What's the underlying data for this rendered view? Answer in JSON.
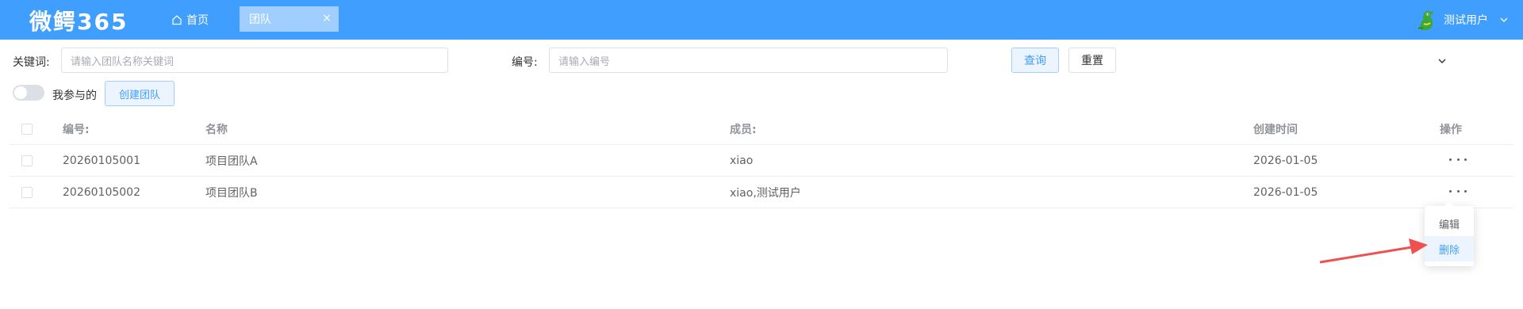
{
  "header": {
    "logo": "微鳄365",
    "nav_home": "首页",
    "active_tab": "团队",
    "user_name": "测试用户",
    "bg_color": "#409eff"
  },
  "search": {
    "keyword_label": "关键词:",
    "keyword_placeholder": "请输入团队名称关键词",
    "code_label": "编号:",
    "code_placeholder": "请输入编号",
    "query_button": "查询",
    "reset_button": "重置"
  },
  "toolbar": {
    "toggle_label": "我参与的",
    "toggle_on": false,
    "create_button": "创建团队"
  },
  "table": {
    "columns": [
      "编号:",
      "名称",
      "成员:",
      "创建时间",
      "操作"
    ],
    "rows": [
      {
        "code": "20260105001",
        "name": "项目团队A",
        "members": "xiao",
        "created": "2026-01-05"
      },
      {
        "code": "20260105002",
        "name": "项目团队B",
        "members": "xiao,测试用户",
        "created": "2026-01-05"
      }
    ]
  },
  "dropdown": {
    "items": [
      "编辑",
      "删除"
    ],
    "highlighted": "删除"
  },
  "colors": {
    "primary": "#409eff",
    "annotation_arrow": "#f05050"
  },
  "icons": [
    "home-icon",
    "close-icon",
    "avatar-icon",
    "chevron-down-icon",
    "more-icon",
    "arrow-annotation"
  ]
}
